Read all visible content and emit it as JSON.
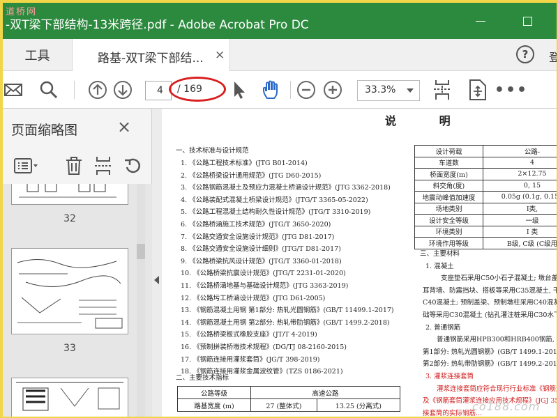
{
  "window": {
    "title": "-双T梁下部结构-13米跨径.pdf - Adobe Acrobat Pro DC",
    "watermark": "道桥网"
  },
  "tabs": {
    "tools_label": "工具",
    "doc_label": "路基-双T梁下部结...",
    "close_glyph": "×",
    "help_glyph": "?",
    "login_label": "登"
  },
  "toolbar": {
    "page_current": "4",
    "page_total": "/ 169",
    "zoom": "33.3%"
  },
  "panel": {
    "title": "页面缩略图",
    "close_glyph": "×",
    "thumb_labels": [
      "32",
      "33"
    ]
  },
  "doc": {
    "title": "说 明",
    "section1": "一、技术标准与设计规范",
    "standards": [
      "1. 《公路工程技术标准》(JTG B01-2014)",
      "2. 《公路桥梁设计通用规范》(JTG D60-2015)",
      "3. 《公路钢筋混凝土及预应力混凝土桥涵设计规范》(JTG 3362-2018)",
      "4. 《公路装配式混凝土桥梁设计规范》(JTG/T 3365-05-2022)",
      "5. 《公路工程混凝土结构耐久性设计规范》(JTG/T 3310-2019)",
      "6. 《公路桥涵施工技术规范》(JTG/T 3650-2020)",
      "7. 《公路交通安全设施设计规范》(JTG D81-2017)",
      "8. 《公路交通安全设施设计细则》(JTG/T D81-2017)",
      "9. 《公路桥梁抗风设计规范》(JTG/T 3360-01-2018)",
      "10. 《公路桥梁抗震设计规范》(JTG/T 2231-01-2020)",
      "11. 《公路桥涵地基与基础设计规范》(JTG 3363-2019)",
      "12. 《公路圬工桥涵设计规范》(JTG D61-2005)",
      "13. 《钢筋混凝土用钢 第1部分: 热轧光圆钢筋》(GB/T 11499.1-2017)",
      "14. 《钢筋混凝土用钢 第2部分: 热轧带肋钢筋》(GB/T 1499.2-2018)",
      "15. 《公路桥梁板式橡胶支座》(JT/T 4-2019)",
      "16. 《预制拼装桥墩技术规程》(DG/TJ 08-2160-2015)",
      "17. 《钢筋连接用灌浆套筒》(JG/T 398-2019)",
      "18. 《钢筋连接用灌浆金属波纹管》(TZS 0186-2021)"
    ],
    "section2": "二、主要技术指标",
    "index_table": [
      [
        "公路等级",
        "高速公路",
        ""
      ],
      [
        "路基宽度 (m)",
        "27 (整体式)",
        "13.25 (分离式)"
      ]
    ],
    "design_params": [
      [
        "设计荷载",
        "公路-"
      ],
      [
        "车道数",
        "4"
      ],
      [
        "桥面宽度(m)",
        "2×12.75"
      ],
      [
        "斜交角(度)",
        "0, 15"
      ],
      [
        "地震动峰值加速度",
        "0.05g (0.1g, 0.15g"
      ],
      [
        "场地类别",
        "I类,"
      ],
      [
        "设计安全等级",
        "一级"
      ],
      [
        "环境类别",
        "I 类"
      ],
      [
        "环境作用等级",
        "B级, C级 (C级用"
      ]
    ],
    "right_text": [
      "三、主要材料",
      "1. 混凝土",
      "支座垫石采用C50小石子混凝土; 墩台盖梁",
      "耳背墙、防震挡块、搭板等采用C35混凝土, 干",
      "C40混凝土; 预制盖梁、预制墩柱采用C40混凝",
      "础等采用C30混凝土 (钻孔灌注桩采用C30水下",
      "2. 普通钢筋",
      "普通钢筋采用HPB300和HRB400钢筋, 钢",
      "第1部分: 热轧光圆钢筋》(GB/T 1499.1-2017) 和",
      "第2部分: 热轧带肋钢筋》(GB/T 1499.2-2018) 的规",
      "3. 灌浆连接套筒",
      "灌浆连接套筒应符合现行行业标准《钢筋连",
      "及《钢筋套筒灌浆连接应用技术规程》(JGJ 355",
      "接套筒的实际钢筋... "
    ],
    "bottom_watermark": "co188.com"
  }
}
